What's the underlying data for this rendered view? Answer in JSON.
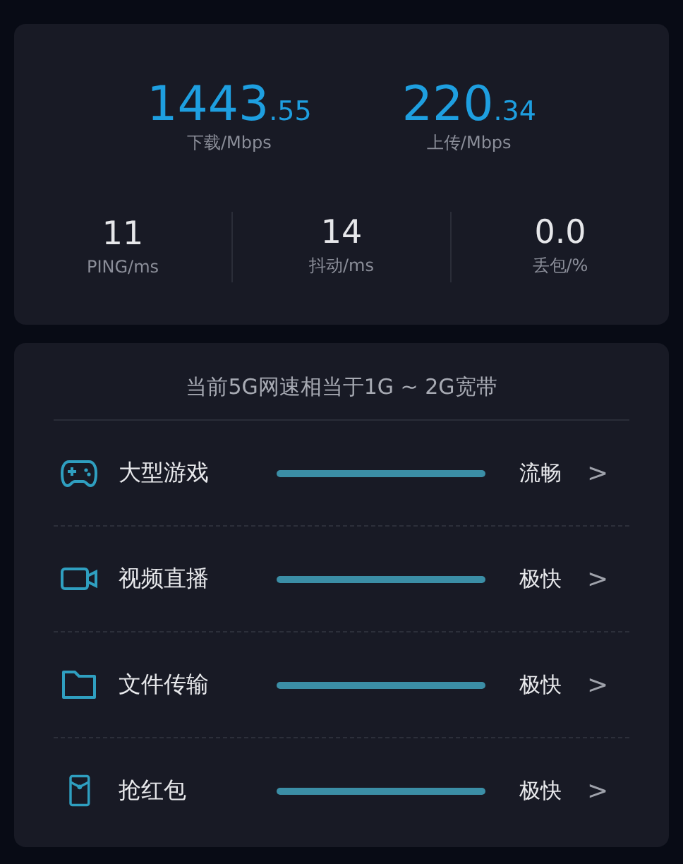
{
  "speeds": [
    {
      "integer": "1443",
      "decimal": ".55",
      "label": "下载/Mbps"
    },
    {
      "integer": "220",
      "decimal": ".34",
      "label": "上传/Mbps"
    }
  ],
  "metrics": [
    {
      "value": "11",
      "label": "PING/ms"
    },
    {
      "value": "14",
      "label": "抖动/ms"
    },
    {
      "value": "0.0",
      "label": "丢包/%"
    }
  ],
  "summary": "当前5G网速相当于1G ~ 2G宽带",
  "scenarios": [
    {
      "kind": "game",
      "name": "大型游戏",
      "rating": "流畅",
      "arrow": ">"
    },
    {
      "kind": "video",
      "name": "视频直播",
      "rating": "极快",
      "arrow": ">"
    },
    {
      "kind": "file",
      "name": "文件传输",
      "rating": "极快",
      "arrow": ">"
    },
    {
      "kind": "envelope",
      "name": "抢红包",
      "rating": "极快",
      "arrow": ">"
    }
  ]
}
